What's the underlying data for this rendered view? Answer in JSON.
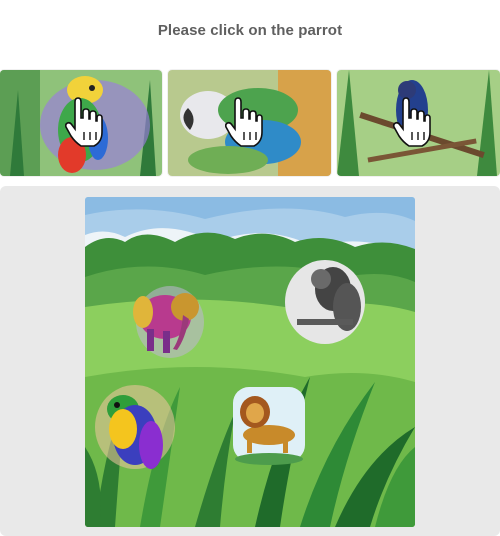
{
  "challenge": {
    "instruction": "Please click on the parrot",
    "example_images": [
      {
        "icon": "parrot-example",
        "cursor": "hand-cursor-icon"
      },
      {
        "icon": "parrot-example",
        "cursor": "hand-cursor-icon"
      },
      {
        "icon": "parrot-example",
        "cursor": "hand-cursor-icon"
      }
    ],
    "scene": {
      "background": "watercolor jungle meadow",
      "animals": [
        "elephant",
        "squirrel",
        "parrot",
        "lion"
      ]
    },
    "colors": {
      "instruction_text": "#5f5f5f",
      "panel_background": "#e9e9e9"
    }
  }
}
